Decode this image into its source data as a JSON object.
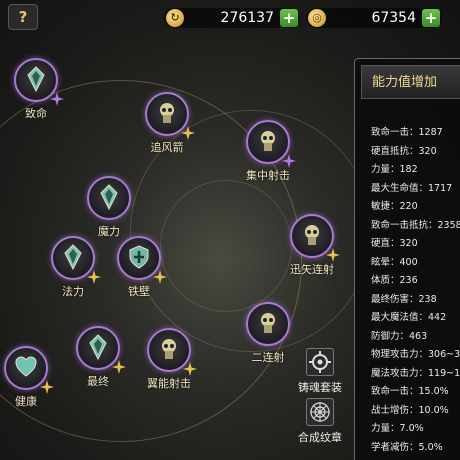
{
  "topbar": {
    "help_label": "?",
    "currency1": {
      "icon": "crystal-currency-icon",
      "value": "276137",
      "add": "+"
    },
    "currency2": {
      "icon": "gold-coin-icon",
      "value": "67354",
      "add": "+"
    }
  },
  "skills": [
    {
      "label": "致命",
      "badge": "purple-star-badge"
    },
    {
      "label": "追风箭",
      "badge": "gold-star-badge"
    },
    {
      "label": "集中射击",
      "badge": "purple-star-badge"
    },
    {
      "label": "魔力",
      "badge": ""
    },
    {
      "label": "迅矢连射",
      "badge": "gold-star-badge"
    },
    {
      "label": "法力",
      "badge": "gold-star-badge"
    },
    {
      "label": "铁壁",
      "badge": "gold-star-badge"
    },
    {
      "label": "二连射",
      "badge": ""
    },
    {
      "label": "最终",
      "badge": "gold-star-badge"
    },
    {
      "label": "翼能射击",
      "badge": "gold-star-badge"
    },
    {
      "label": "健康",
      "badge": "gold-star-badge"
    }
  ],
  "side_buttons": {
    "forge_set": "铸魂套装",
    "compose_emblem": "合成纹章"
  },
  "stats_panel": {
    "title": "能力值增加",
    "rows": [
      "致命一击：1287",
      "硬直抵抗：320",
      "力量：182",
      "最大生命值：1717",
      "敏捷：220",
      "致命一击抵抗：2358",
      "硬直：320",
      "眩晕：400",
      "体质：236",
      "最终伤害：238",
      "最大魔法值：442",
      "防御力：463",
      "物理攻击力：306~3",
      "魔法攻击力：119~11",
      "致命一击：15.0%",
      "战士增伤：10.0%",
      "力量：7.0%",
      "学者减伤：5.0%"
    ]
  },
  "colors": {
    "accent_gold": "#f4d890",
    "orb_border": "#a97ad0",
    "plus_green": "#4ea83a"
  }
}
